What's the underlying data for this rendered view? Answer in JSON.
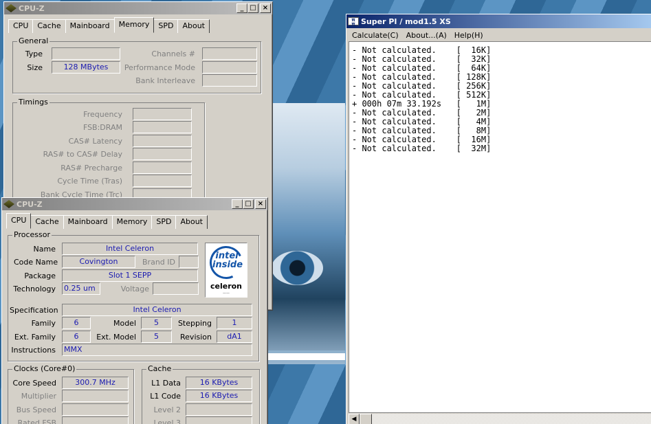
{
  "cpuz_memory": {
    "title": "CPU-Z",
    "tabs": [
      "CPU",
      "Cache",
      "Mainboard",
      "Memory",
      "SPD",
      "About"
    ],
    "selected_tab": "Memory",
    "general": {
      "label": "General",
      "type_label": "Type",
      "type_value": "",
      "size_label": "Size",
      "size_value": "128 MBytes",
      "channels_label": "Channels #",
      "performance_label": "Performance Mode",
      "bank_label": "Bank Interleave"
    },
    "timings": {
      "label": "Timings",
      "rows": [
        "Frequency",
        "FSB:DRAM",
        "CAS# Latency",
        "RAS# to CAS# Delay",
        "RAS# Precharge",
        "Cycle Time (Tras)",
        "Bank Cycle Time (Trc)"
      ]
    }
  },
  "cpuz_cpu": {
    "title": "CPU-Z",
    "tabs": [
      "CPU",
      "Cache",
      "Mainboard",
      "Memory",
      "SPD",
      "About"
    ],
    "selected_tab": "CPU",
    "processor": {
      "label": "Processor",
      "name_label": "Name",
      "name": "Intel Celeron",
      "codename_label": "Code Name",
      "codename": "Covington",
      "brandid_label": "Brand ID",
      "brandid": "",
      "package_label": "Package",
      "package": "Slot 1 SEPP",
      "technology_label": "Technology",
      "technology": "0.25 um",
      "voltage_label": "Voltage",
      "voltage": ""
    },
    "spec": {
      "specification_label": "Specification",
      "specification": "Intel Celeron",
      "family_label": "Family",
      "family": "6",
      "model_label": "Model",
      "model": "5",
      "stepping_label": "Stepping",
      "stepping": "1",
      "extfamily_label": "Ext. Family",
      "extfamily": "6",
      "extmodel_label": "Ext. Model",
      "extmodel": "5",
      "revision_label": "Revision",
      "revision": "dA1",
      "instructions_label": "Instructions",
      "instructions": "MMX"
    },
    "logo": {
      "line1": "intel",
      "line2": "inside",
      "brand": "celeron"
    },
    "clocks": {
      "label": "Clocks (Core#0)",
      "corespeed_label": "Core Speed",
      "corespeed": "300.7 MHz",
      "multiplier_label": "Multiplier",
      "busspeed_label": "Bus Speed",
      "ratedfsb_label": "Rated FSB"
    },
    "cache": {
      "label": "Cache",
      "l1data_label": "L1 Data",
      "l1data": "16 KBytes",
      "l1code_label": "L1 Code",
      "l1code": "16 KBytes",
      "level2_label": "Level 2",
      "level3_label": "Level 3"
    }
  },
  "superpi": {
    "title": "Super PI / mod1.5 XS",
    "menu": [
      "Calculate(C)",
      "About...(A)",
      "Help(H)"
    ],
    "lines": [
      "- Not calculated.    [  16K]",
      "- Not calculated.    [  32K]",
      "- Not calculated.    [  64K]",
      "- Not calculated.    [ 128K]",
      "- Not calculated.    [ 256K]",
      "- Not calculated.    [ 512K]",
      "+ 000h 07m 33.192s   [   1M]",
      "- Not calculated.    [   2M]",
      "- Not calculated.    [   4M]",
      "- Not calculated.    [   8M]",
      "- Not calculated.    [  16M]",
      "- Not calculated.    [  32M]"
    ]
  },
  "icons": {
    "cpuz": "chip-icon",
    "superpi": "superpi-app-icon"
  }
}
